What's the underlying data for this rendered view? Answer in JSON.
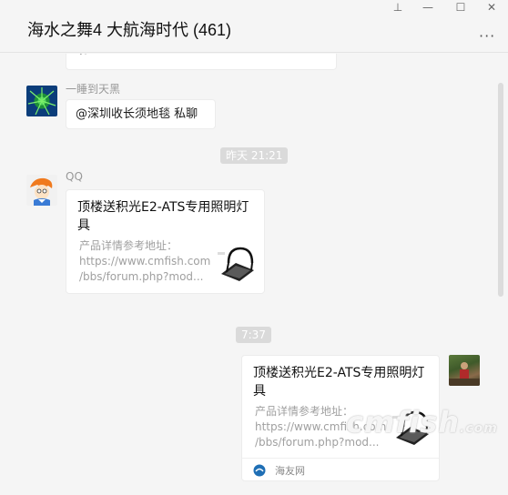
{
  "window": {
    "title": "海水之舞4 大航海时代 (461)",
    "controls": {
      "pin": "⊥",
      "minimize": "—",
      "maximize": "☐",
      "close": "✕"
    },
    "more": "···"
  },
  "messages": [
    {
      "kind": "text-partial",
      "text": "啊"
    },
    {
      "kind": "text",
      "sender": "一睡到天黑",
      "text": "@深圳收长须地毯 私聊"
    },
    {
      "kind": "time",
      "text": "昨天 21:21"
    },
    {
      "kind": "card",
      "sender": "QQ",
      "title": "顶楼送积光E2-ATS专用照明灯具",
      "desc": [
        "产品详情参考地址：",
        "https://www.cmfish.com",
        "/bbs/forum.php?mod..."
      ]
    },
    {
      "kind": "time",
      "text": "7:37"
    },
    {
      "kind": "card",
      "sender": "",
      "title": "顶楼送积光E2-ATS专用照明灯具",
      "desc": [
        "产品详情参考地址：",
        "https://www.cmfish.com",
        "/bbs/forum.php?mod..."
      ],
      "source": "海友网"
    }
  ],
  "watermark": {
    "main": "cmfish",
    "suffix": ".com"
  },
  "colors": {
    "background": "#f5f5f5",
    "bubble": "#ffffff",
    "time_pill": "#dadada",
    "meta_text": "#999999"
  }
}
